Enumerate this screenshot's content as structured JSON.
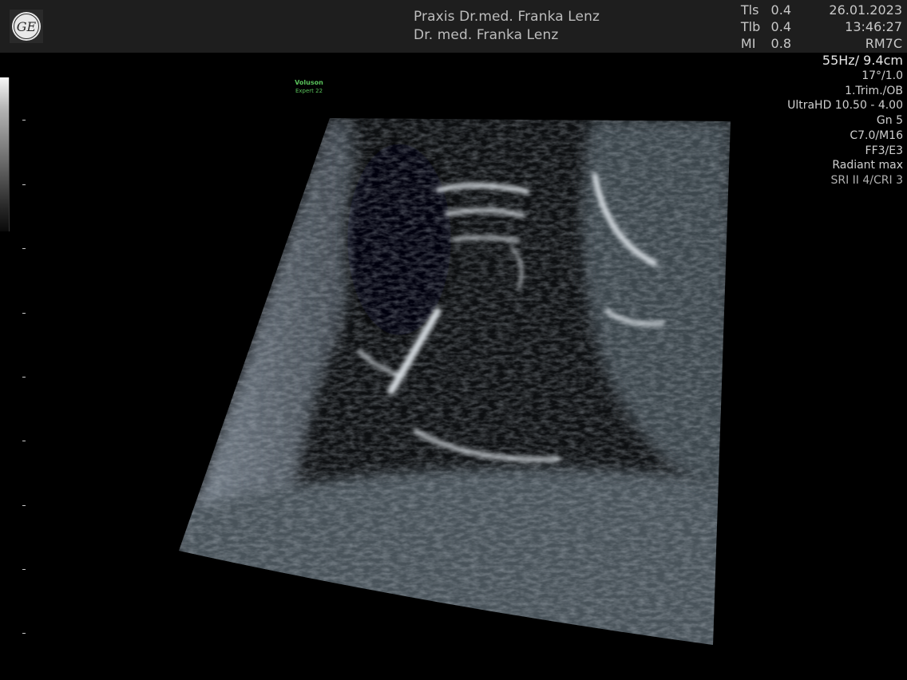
{
  "header": {
    "practice_line1": "Praxis Dr.med. Franka Lenz",
    "practice_line2": "Dr. med. Franka Lenz",
    "indices": [
      {
        "label": "Tls",
        "value": "0.4"
      },
      {
        "label": "Tlb",
        "value": "0.4"
      },
      {
        "label": "MI",
        "value": "0.8"
      }
    ],
    "date": "26.01.2023",
    "time": "13:46:27",
    "probe": "RM7C",
    "logo_icon": "ge-logo-icon"
  },
  "params": [
    "55Hz/ 9.4cm",
    "17°/1.0",
    "1.Trim./OB",
    "UltraHD 10.50 - 4.00",
    "Gn  5",
    "C7.0/M16",
    "FF3/E3",
    "Radiant max",
    "SRI II 4/CRI 3"
  ],
  "brand": {
    "line1": "Voluson",
    "line2": "Expert 22",
    "color": "#59c25b"
  },
  "colors": {
    "header_bg": "#1e1e1e",
    "background": "#000000"
  }
}
